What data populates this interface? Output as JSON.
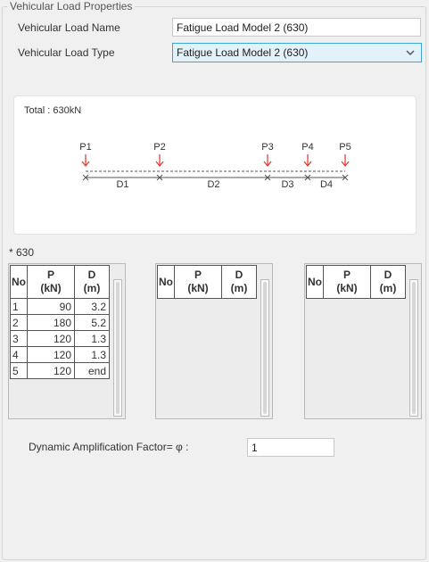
{
  "group_title": "Vehicular Load Properties",
  "name_field": {
    "label": "Vehicular Load Name",
    "value": "Fatigue Load Model 2 (630)"
  },
  "type_field": {
    "label": "Vehicular Load Type",
    "value": "Fatigue Load Model 2 (630)"
  },
  "diagram": {
    "total": "Total : 630kN",
    "loads": [
      "P1",
      "P2",
      "P3",
      "P4",
      "P5"
    ],
    "spacings": [
      "D1",
      "D2",
      "D3",
      "D4"
    ],
    "arrow_color": "#e0403a"
  },
  "section_caption": "* 630",
  "tables": [
    {
      "headers": {
        "no": "No",
        "p_top": "P",
        "p_unit": "(kN)",
        "d_top": "D",
        "d_unit": "(m)"
      },
      "rows": [
        {
          "no": "1",
          "p": "90",
          "d": "3.2"
        },
        {
          "no": "2",
          "p": "180",
          "d": "5.2"
        },
        {
          "no": "3",
          "p": "120",
          "d": "1.3"
        },
        {
          "no": "4",
          "p": "120",
          "d": "1.3"
        },
        {
          "no": "5",
          "p": "120",
          "d": "end"
        }
      ]
    },
    {
      "headers": {
        "no": "No",
        "p_top": "P",
        "p_unit": "(kN)",
        "d_top": "D",
        "d_unit": "(m)"
      },
      "rows": []
    },
    {
      "headers": {
        "no": "No",
        "p_top": "P",
        "p_unit": "(kN)",
        "d_top": "D",
        "d_unit": "(m)"
      },
      "rows": []
    }
  ],
  "daf": {
    "label": "Dynamic Amplification Factor= φ :",
    "value": "1"
  },
  "colors": {
    "accent": "#3aa7d8",
    "select_bg": "#e3f1fa",
    "load_arrow": "#e0403a"
  }
}
